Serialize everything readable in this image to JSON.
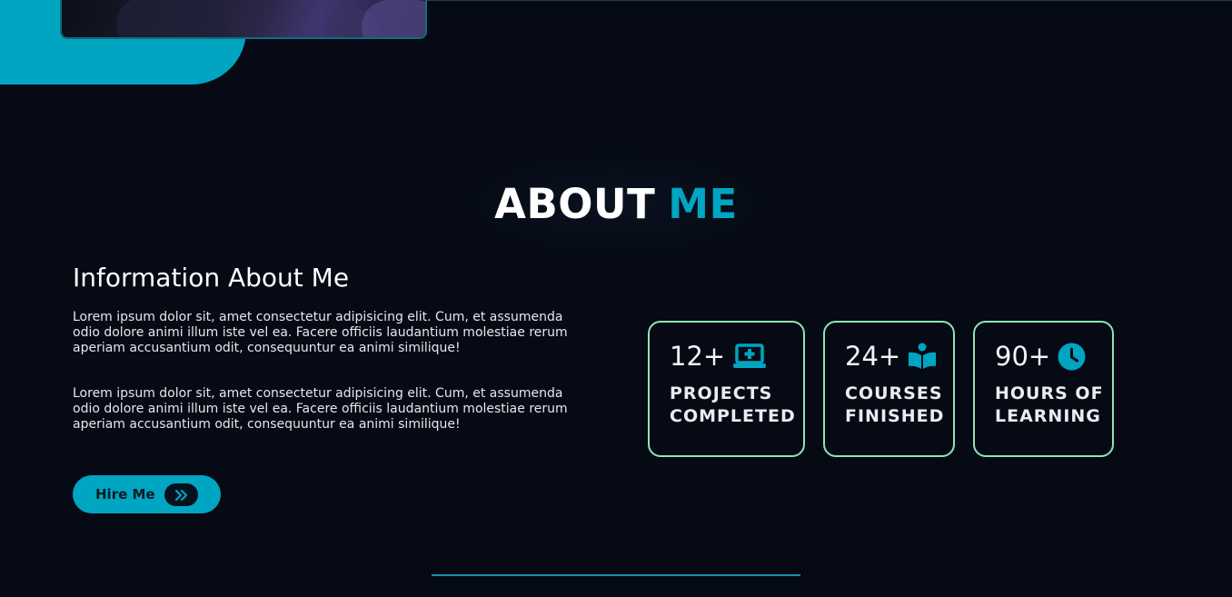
{
  "section": {
    "title_word1": "ABOUT",
    "title_word2": "ME"
  },
  "info": {
    "heading": "Information About Me",
    "paragraphs": [
      "Lorem ipsum dolor sit, amet consectetur adipisicing elit. Cum, et assumenda odio dolore animi illum iste vel ea. Facere officiis laudantium molestiae rerum aperiam accusantium odit, consequuntur ea animi similique!",
      "Lorem ipsum dolor sit, amet consectetur adipisicing elit. Cum, et assumenda odio dolore animi illum iste vel ea. Facere officiis laudantium molestiae rerum aperiam accusantium odit, consequuntur ea animi similique!"
    ]
  },
  "hire_button": {
    "label": "Hire Me",
    "icon": "double-chevron-right-icon"
  },
  "stats": [
    {
      "value": "12+",
      "line1": "PROJECTS",
      "line2": "COMPLETED",
      "icon": "laptop-code-icon"
    },
    {
      "value": "24+",
      "line1": "COURSES",
      "line2": "FINISHED",
      "icon": "book-reader-icon"
    },
    {
      "value": "90+",
      "line1": "HOURS OF",
      "line2": "LEARNING",
      "icon": "clock-icon"
    }
  ],
  "colors": {
    "accent": "#00a5c2",
    "background": "#050a14",
    "card_border": "#8ee5b3"
  }
}
